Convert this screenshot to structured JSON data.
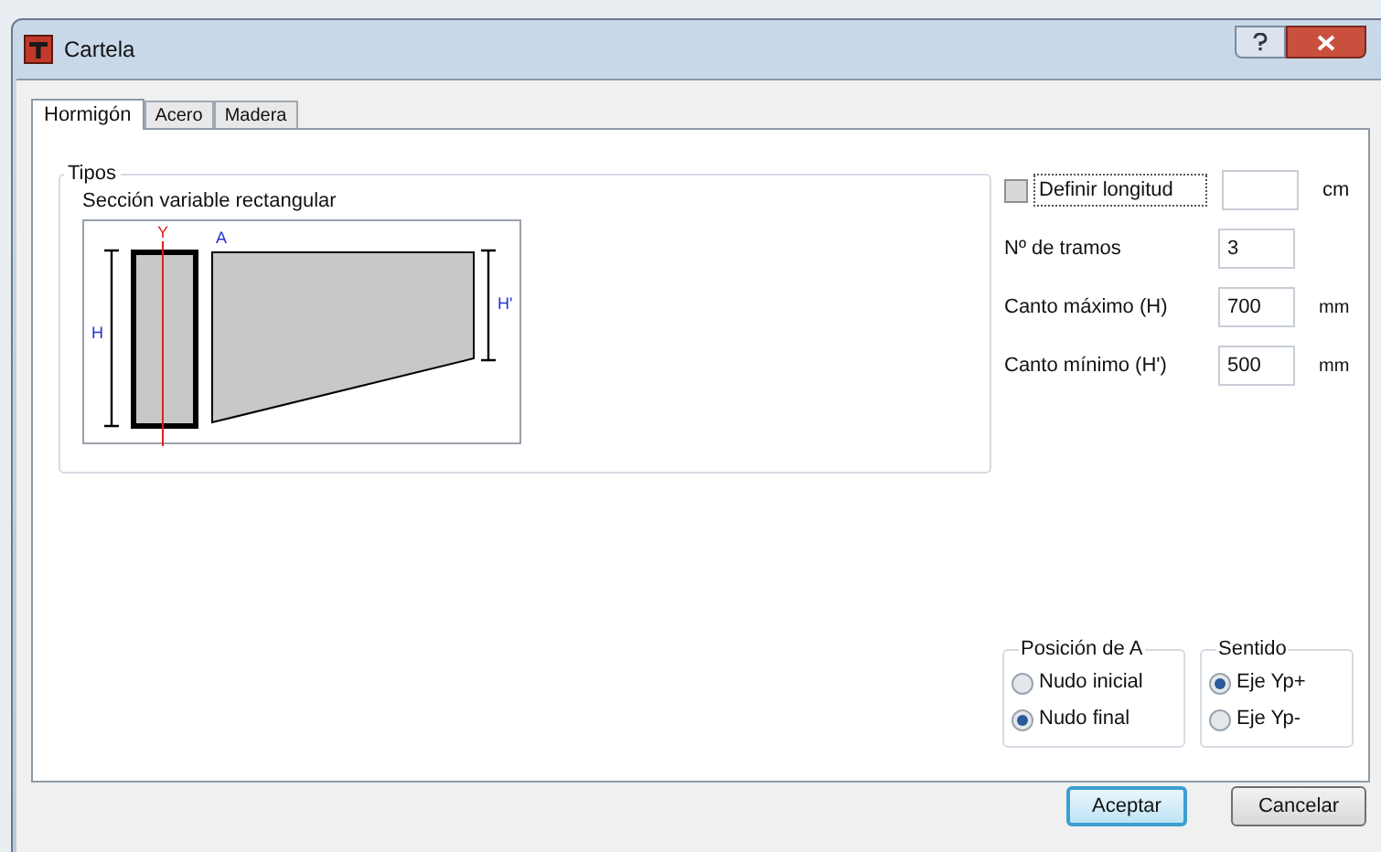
{
  "window": {
    "title": "Cartela"
  },
  "tabs": [
    {
      "label": "Hormigón",
      "selected": true
    },
    {
      "label": "Acero",
      "selected": false
    },
    {
      "label": "Madera",
      "selected": false
    }
  ],
  "tipos": {
    "legend": "Tipos",
    "section_label": "Sección variable rectangular",
    "diagram_labels": {
      "axis": "Y",
      "point": "A",
      "height": "H",
      "min_height": "H'"
    }
  },
  "definir_longitud": {
    "label": "Definir longitud",
    "checked": false,
    "unit": "cm"
  },
  "fields": [
    {
      "label": "Nº de tramos",
      "value": "3"
    },
    {
      "label": "Canto máximo (H)",
      "value": "700",
      "unit": "mm"
    },
    {
      "label": "Canto mínimo (H')",
      "value": "500",
      "unit": "mm"
    }
  ],
  "radio_groups": [
    {
      "legend": "Posición de A",
      "options": [
        {
          "label": "Nudo inicial",
          "selected": false
        },
        {
          "label": "Nudo final",
          "selected": true
        }
      ]
    },
    {
      "legend": "Sentido",
      "options": [
        {
          "label": "Eje Yp+",
          "selected": true
        },
        {
          "label": "Eje Yp-",
          "selected": false
        }
      ]
    }
  ],
  "buttons": [
    {
      "label": "Aceptar",
      "default": true
    },
    {
      "label": "Cancelar",
      "default": false
    }
  ]
}
